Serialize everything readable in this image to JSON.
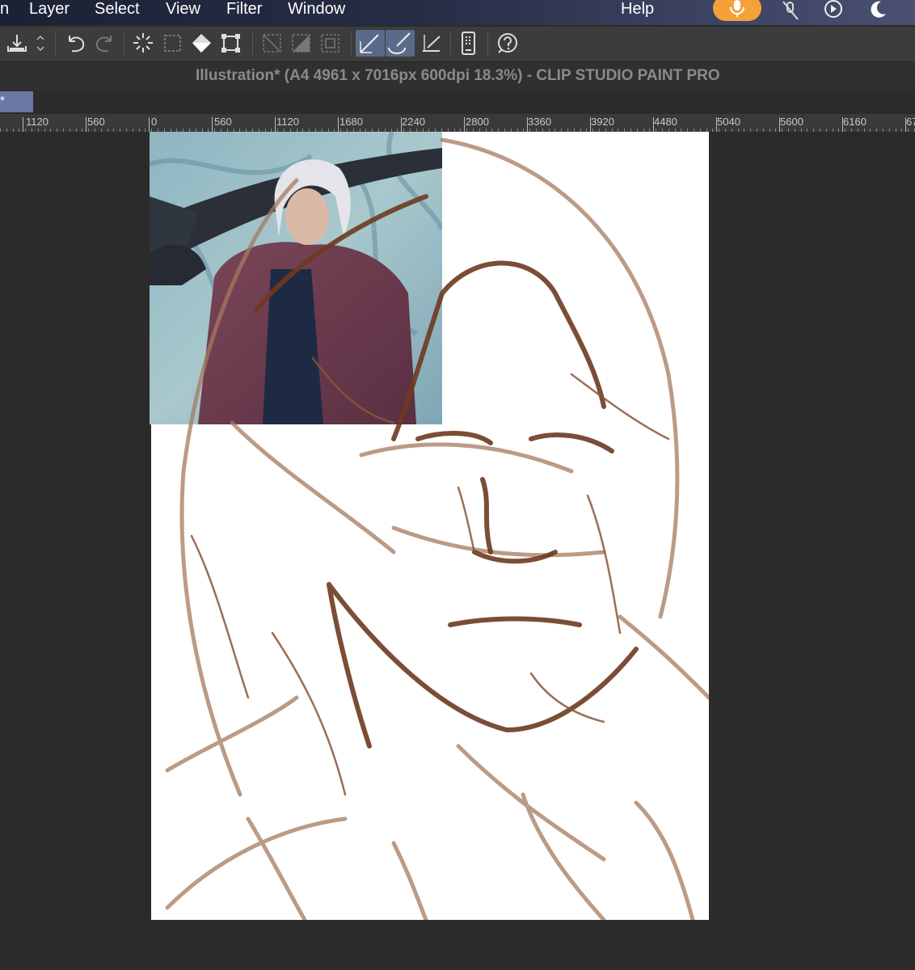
{
  "menu": {
    "partial_item": "n",
    "items": [
      "Layer",
      "Select",
      "View",
      "Filter",
      "Window"
    ],
    "help": "Help"
  },
  "status_icons": [
    "microphone-icon",
    "mute-icon",
    "play-circle-icon",
    "moon-icon"
  ],
  "toolbar": {
    "icons": [
      "import-icon",
      "stepper-icon",
      "undo-icon",
      "redo-icon",
      "select-all-icon",
      "deselect-icon",
      "fill-icon",
      "transform-icon",
      "selection-launcher-icon-1",
      "selection-launcher-icon-2",
      "selection-launcher-icon-3",
      "pen-stabilization-icon",
      "brush-icon",
      "ruler-snap-icon",
      "smartphone-icon",
      "help-icon"
    ]
  },
  "window": {
    "title": "Illustration* (A4 4961 x 7016px 600dpi 18.3%)  - CLIP STUDIO PAINT PRO"
  },
  "document_tab": {
    "label": "*"
  },
  "ruler": {
    "labels": [
      "1120",
      "560",
      "0",
      "560",
      "1120",
      "1680",
      "2240",
      "2800",
      "3360",
      "3920",
      "4480",
      "5040",
      "5600",
      "6160",
      "67"
    ]
  },
  "colors": {
    "accent_orange": "#f5a13a",
    "active_tool": "#5a6a8a",
    "document_tab": "#6a78a6",
    "sketch_brown": "#7a4a30",
    "workspace": "#2b2b2b"
  }
}
